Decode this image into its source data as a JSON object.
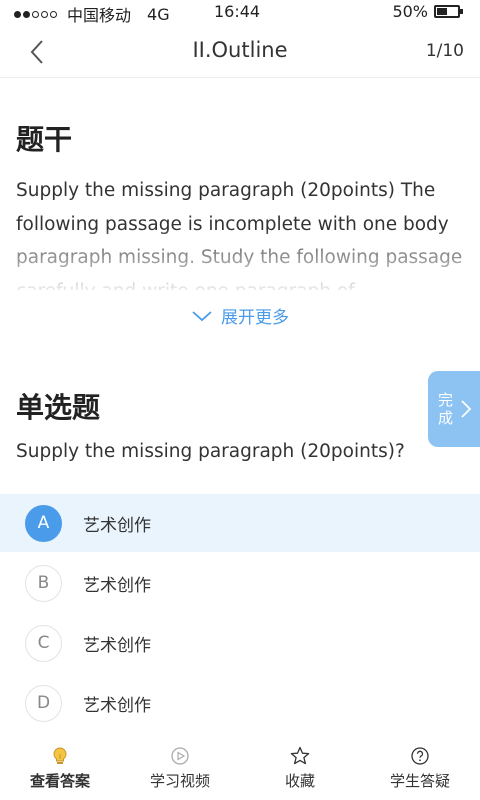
{
  "status_bar": {
    "carrier": "中国移动",
    "network": "4G",
    "time": "16:44",
    "battery": "50%",
    "battery_level": 0.5
  },
  "nav": {
    "title": "II.Outline",
    "page_indicator": "1/10"
  },
  "stem": {
    "heading": "题干",
    "text": "Supply the missing paragraph (20points) The following passage is incomplete with one body paragraph missing. Study the following passage carefully and write one paragraph of",
    "expand_label": "展开更多"
  },
  "question": {
    "heading": "单选题",
    "text": "Supply the missing paragraph (20points)?",
    "done_label": "完成",
    "options": [
      {
        "letter": "A",
        "label": "艺术创作",
        "selected": true
      },
      {
        "letter": "B",
        "label": "艺术创作",
        "selected": false
      },
      {
        "letter": "C",
        "label": "艺术创作",
        "selected": false
      },
      {
        "letter": "D",
        "label": "艺术创作",
        "selected": false
      }
    ]
  },
  "tabbar": {
    "tabs": [
      {
        "label": "查看答案",
        "icon": "lightbulb-icon"
      },
      {
        "label": "学习视频",
        "icon": "play-circle-icon"
      },
      {
        "label": "收藏",
        "icon": "star-icon"
      },
      {
        "label": "学生答疑",
        "icon": "question-circle-icon"
      }
    ]
  },
  "colors": {
    "accent": "#4a9bea",
    "selected_row": "#eaf4fd",
    "done_tab": "#8cc3f3",
    "tab_active_icon": "#f4c542"
  }
}
